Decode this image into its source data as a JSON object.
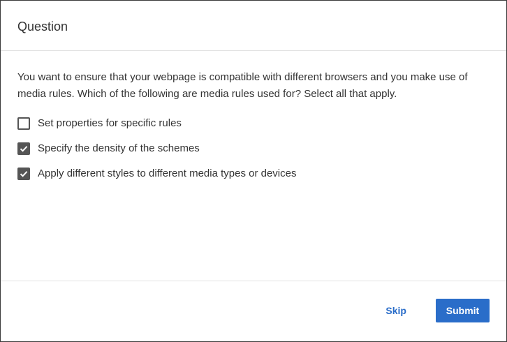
{
  "dialog": {
    "title": "Question",
    "prompt": "You want to ensure that your webpage is compatible with different browsers and you make use of media rules. Which of the following are media rules used for? Select all that apply.",
    "options": [
      {
        "label": "Set properties for specific rules",
        "checked": false
      },
      {
        "label": "Specify the density of the schemes",
        "checked": true
      },
      {
        "label": "Apply different styles to different media types or devices",
        "checked": true
      }
    ]
  },
  "footer": {
    "skip_label": "Skip",
    "submit_label": "Submit"
  },
  "colors": {
    "accent": "#2a6dc9",
    "checkbox": "#555555",
    "text": "#333333"
  },
  "icons": {
    "checked": "checkmark-icon"
  }
}
